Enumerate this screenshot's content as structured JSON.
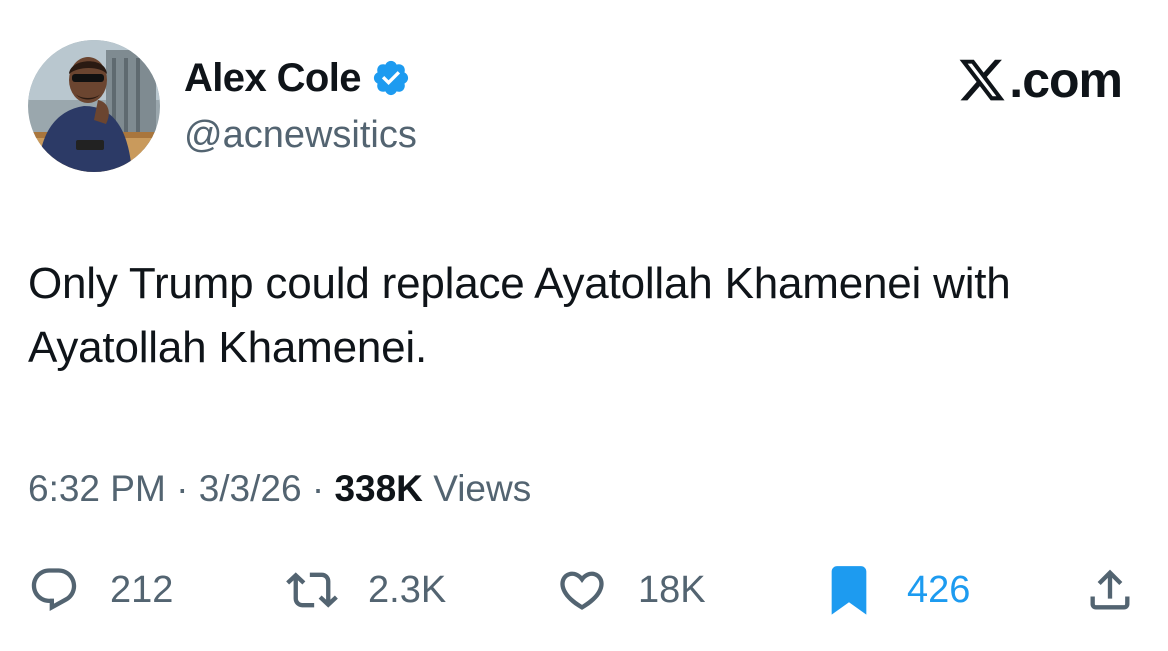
{
  "author": {
    "display_name": "Alex Cole",
    "handle": "@acnewsitics",
    "verified": true,
    "verified_color": "#1d9bf0"
  },
  "brand": {
    "label": ".com",
    "icon": "x-logo-icon"
  },
  "tweet": {
    "text": "Only Trump could replace Ayatollah Khamenei with Ayatollah Khamenei."
  },
  "meta": {
    "time": "6:32 PM",
    "separator": "·",
    "date": "3/3/26",
    "views_count": "338K",
    "views_label": "Views"
  },
  "actions": {
    "replies": {
      "icon": "reply-icon",
      "count": "212"
    },
    "reposts": {
      "icon": "repost-icon",
      "count": "2.3K"
    },
    "likes": {
      "icon": "heart-icon",
      "count": "18K"
    },
    "bookmarks": {
      "icon": "bookmark-icon",
      "count": "426",
      "active": true,
      "color": "#1d9bf0"
    },
    "share": {
      "icon": "share-icon"
    }
  },
  "colors": {
    "text_primary": "#0f1419",
    "text_secondary": "#536471",
    "accent": "#1d9bf0"
  }
}
